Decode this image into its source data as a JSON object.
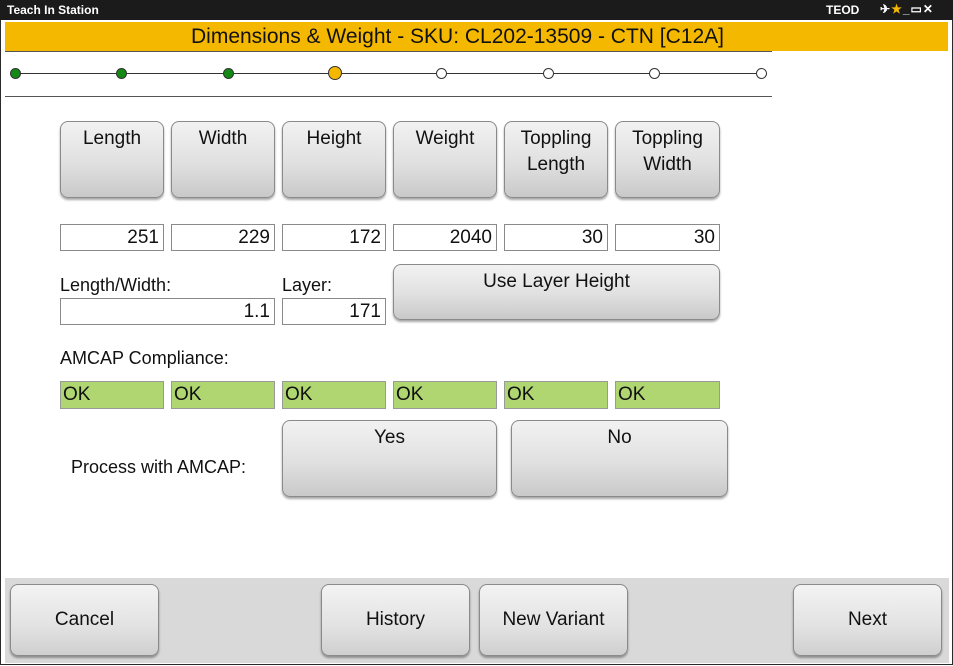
{
  "window": {
    "app_title": "Teach In Station",
    "user": "TEOD",
    "controls": "✈★_▭✕"
  },
  "header": {
    "title": "Dimensions & Weight - SKU: CL202-13509 - CTN [C12A]",
    "accent_color": "#f5b800"
  },
  "progress": {
    "total_steps": 8,
    "completed_steps": 3,
    "current_step": 4
  },
  "dims": {
    "buttons": [
      {
        "line1": "Length",
        "line2": ""
      },
      {
        "line1": "Width",
        "line2": ""
      },
      {
        "line1": "Height",
        "line2": ""
      },
      {
        "line1": "Weight",
        "line2": ""
      },
      {
        "line1": "Toppling",
        "line2": "Length"
      },
      {
        "line1": "Toppling",
        "line2": "Width"
      }
    ],
    "values": [
      "251",
      "229",
      "172",
      "2040",
      "30",
      "30"
    ]
  },
  "ratio": {
    "label": "Length/Width:",
    "value": "1.1"
  },
  "layer": {
    "label": "Layer:",
    "value": "171"
  },
  "use_layer_height": "Use Layer Height",
  "amcap": {
    "label": "AMCAP Compliance:",
    "status": [
      "OK",
      "OK",
      "OK",
      "OK",
      "OK",
      "OK"
    ],
    "ok_color": "#afd671",
    "process_label": "Process with AMCAP:",
    "yes": "Yes",
    "no": "No"
  },
  "footer": {
    "cancel": "Cancel",
    "history": "History",
    "new_variant": "New Variant",
    "next": "Next"
  }
}
